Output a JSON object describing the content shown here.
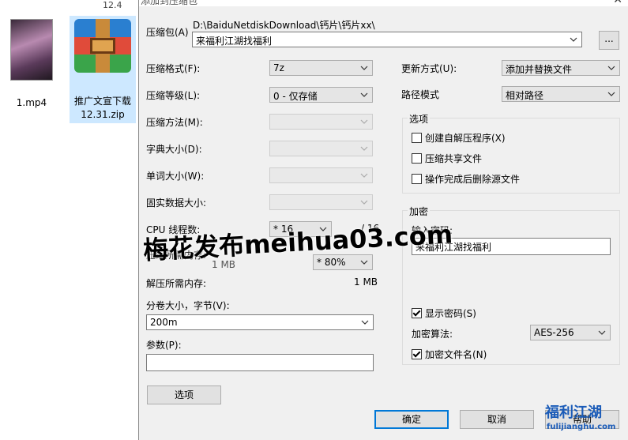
{
  "explorer": {
    "top_fragment": "12.4",
    "files": [
      {
        "name": "1.mp4"
      },
      {
        "name": "推广文宣下载",
        "name2": "12.31.zip"
      }
    ]
  },
  "dialog": {
    "title": "添加到压缩包",
    "archive_label": "压缩包(A)",
    "archive_path": "D:\\BaiduNetdiskDownload\\钙片\\钙片xx\\",
    "archive_name": "来福利江湖找福利",
    "browse_label": "...",
    "format_label": "压缩格式(F):",
    "format_value": "7z",
    "level_label": "压缩等级(L):",
    "level_value": "0 - 仅存储",
    "method_label": "压缩方法(M):",
    "dict_label": "字典大小(D):",
    "word_label": "单词大小(W):",
    "solid_label": "固实数据大小:",
    "cpu_label": "CPU 线程数:",
    "cpu_value": "* 16",
    "cpu_total": "/ 16",
    "mem_compress_label": "压缩所需内存:",
    "mem_compress_value": "1 MB",
    "mem_percent": "* 80%",
    "mem_decompress_label": "解压所需内存:",
    "mem_decompress_value": "1 MB",
    "split_label": "分卷大小，字节(V):",
    "split_value": "200m",
    "params_label": "参数(P):",
    "params_value": "",
    "options_button": "选项",
    "update_label": "更新方式(U):",
    "update_value": "添加并替换文件",
    "path_label": "路径模式",
    "path_value": "相对路径",
    "options_group": "选项",
    "opt_sfx": "创建自解压程序(X)",
    "opt_shared": "压缩共享文件",
    "opt_delete": "操作完成后删除源文件",
    "encrypt_group": "加密",
    "password_label": "输入密码:",
    "password_value": "来福利江湖找福利",
    "show_password": "显示密码(S)",
    "enc_method_label": "加密算法:",
    "enc_method_value": "AES-256",
    "encrypt_names": "加密文件名(N)",
    "ok": "确定",
    "cancel": "取消",
    "help": "帮助"
  },
  "watermarks": {
    "main": "梅花发布meihua03.com",
    "brand": "福利江湖",
    "url": "fulijianghu.com"
  }
}
